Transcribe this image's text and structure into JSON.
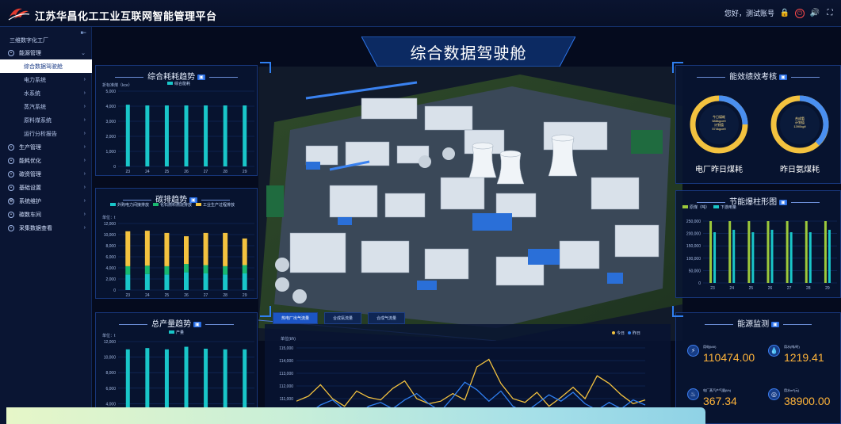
{
  "app": {
    "title": "江苏华昌化工工业互联网智能管理平台",
    "user_text": "您好，测试账号",
    "colors": {
      "accent": "#2f7ff0",
      "bar_teal": "#19c6c9",
      "bar_yellow": "#f3c23f",
      "bar_green": "#18b870",
      "panel_bg": "#081432"
    }
  },
  "sidebar": {
    "header": "三维数字化工厂",
    "collapse_icon": "menu-fold-icon",
    "items": [
      {
        "label": "能源管理",
        "type": "group",
        "icon": "circle-icon"
      },
      {
        "label": "综合数据驾驶舱",
        "type": "sub",
        "active": true
      },
      {
        "label": "电力系统",
        "type": "sub"
      },
      {
        "label": "水系统",
        "type": "sub"
      },
      {
        "label": "蒸汽系统",
        "type": "sub"
      },
      {
        "label": "原料煤系统",
        "type": "sub"
      },
      {
        "label": "运行分析报告",
        "type": "sub"
      },
      {
        "label": "生产管理",
        "type": "group",
        "icon": "circle-icon"
      },
      {
        "label": "能耗优化",
        "type": "group",
        "icon": "circle-icon"
      },
      {
        "label": "碳资管理",
        "type": "group",
        "icon": "circle-icon"
      },
      {
        "label": "基础设置",
        "type": "group",
        "icon": "circle-icon"
      },
      {
        "label": "系统维护",
        "type": "group",
        "icon": "wrench-icon"
      },
      {
        "label": "碳数车间",
        "type": "group",
        "icon": "circle-icon"
      },
      {
        "label": "采集数据查看",
        "type": "group",
        "icon": "circle-icon"
      }
    ]
  },
  "dashboard": {
    "title": "综合数据驾驶舱",
    "tabs": [
      "热电厂出气流量",
      "合成氨流量",
      "合成气流量"
    ]
  },
  "chart_data": [
    {
      "type": "bar",
      "title": "综合耗耗趋势",
      "ylabel": "折标准煤（kce）",
      "legend": [
        "综合能耗"
      ],
      "categories": [
        "23",
        "24",
        "25",
        "26",
        "27",
        "28",
        "29"
      ],
      "values": [
        4100,
        4050,
        4050,
        4050,
        4050,
        4050,
        4050
      ],
      "ylim": [
        0,
        5000
      ],
      "yticks": [
        "5,000",
        "4,000",
        "3,000",
        "2,000",
        "1,000",
        "0"
      ]
    },
    {
      "type": "bar",
      "title": "碳排趋势",
      "ylabel": "单位：t",
      "legend": [
        "外购电力间接排放",
        "化石燃料燃烧排放",
        "工业生产过程排放"
      ],
      "categories": [
        "23",
        "24",
        "25",
        "26",
        "27",
        "28",
        "29"
      ],
      "series": [
        {
          "name": "外购电力间接排放",
          "values": [
            2800,
            2900,
            2800,
            3200,
            3000,
            2800,
            3000
          ]
        },
        {
          "name": "化石燃料燃烧排放",
          "values": [
            1500,
            1500,
            1500,
            1500,
            1500,
            1500,
            1500
          ]
        },
        {
          "name": "工业生产过程排放",
          "values": [
            6300,
            6300,
            6000,
            5000,
            5800,
            6000,
            4800
          ]
        }
      ],
      "ylim": [
        0,
        12000
      ],
      "yticks": [
        "12,000",
        "10,000",
        "8,000",
        "6,000",
        "4,000",
        "2,000",
        "0"
      ]
    },
    {
      "type": "bar",
      "title": "总产量趋势",
      "ylabel": "单位：t",
      "legend": [
        "产量"
      ],
      "categories": [
        "23",
        "24",
        "25",
        "26",
        "27",
        "28",
        "29"
      ],
      "values": [
        10800,
        11000,
        10800,
        11200,
        10900,
        10800,
        10800
      ],
      "ylim": [
        0,
        12000
      ],
      "yticks": [
        "12,000",
        "10,000",
        "8,000",
        "6,000",
        "4,000",
        "2,000"
      ]
    },
    {
      "type": "bar",
      "title": "节能爆柱形图",
      "legend": [
        "原煤（吨）",
        "下游用量"
      ],
      "categories": [
        "23",
        "24",
        "25",
        "26",
        "27",
        "28",
        "29"
      ],
      "series": [
        {
          "name": "原煤（吨）",
          "values": [
            255000,
            255000,
            250000,
            255000,
            250000,
            255000,
            255000
          ]
        },
        {
          "name": "下游用量",
          "values": [
            205000,
            215000,
            205000,
            215000,
            205000,
            205000,
            215000
          ]
        }
      ],
      "ylim": [
        0,
        250000
      ],
      "yticks": [
        "250,000",
        "200,000",
        "150,000",
        "100,000",
        "50,000",
        "0"
      ]
    },
    {
      "type": "line",
      "ylabel": "单位(t/h)",
      "legend": [
        "今日",
        "昨日"
      ],
      "ylim": [
        109000,
        115000
      ],
      "yticks": [
        "115,000",
        "114,000",
        "113,000",
        "112,000",
        "111,000",
        "110,000",
        "109,000"
      ],
      "series": [
        {
          "name": "今日",
          "color": "#f3c23f",
          "values": [
            110800,
            111200,
            112100,
            111000,
            110400,
            111600,
            111100,
            110900,
            111800,
            112400,
            111000,
            110600,
            110800,
            111400,
            110900,
            113500,
            114100,
            112200,
            111000,
            110700,
            111500,
            110400,
            111100,
            111900,
            111000,
            112800,
            112200,
            111300,
            110600,
            110900
          ]
        },
        {
          "name": "昨日",
          "color": "#2f7ff0",
          "values": [
            110300,
            109800,
            110500,
            110900,
            110100,
            109600,
            110400,
            110700,
            110200,
            110900,
            111400,
            110600,
            110000,
            111100,
            112300,
            111700,
            110800,
            111600,
            110400,
            109900,
            110600,
            111300,
            110800,
            111500,
            110600,
            110100,
            110700,
            110200,
            110900,
            110500
          ]
        }
      ]
    }
  ],
  "right_panels": {
    "kpi_title": "能效绩效考核",
    "gauges": [
      {
        "label": "电厂昨日煤耗",
        "lines": [
          "今日煤耗",
          "588kgce/t",
          "计划值",
          "574kgce/t"
        ]
      },
      {
        "label": "昨日氨煤耗",
        "lines": [
          "合成氨",
          "计划值",
          "1390kg/t"
        ]
      }
    ],
    "energy_title": "能源监测",
    "energy": [
      {
        "label": "用电(kW)",
        "value": "110474.00",
        "icon": "bolt-icon"
      },
      {
        "label": "用水(吨/时)",
        "value": "1219.41",
        "icon": "water-icon"
      },
      {
        "label": "电厂蒸汽产气量(t/h)",
        "value": "367.34",
        "icon": "steam-icon"
      },
      {
        "label": "用水m³(元)",
        "value": "38900.00",
        "icon": "meter-icon"
      }
    ]
  }
}
